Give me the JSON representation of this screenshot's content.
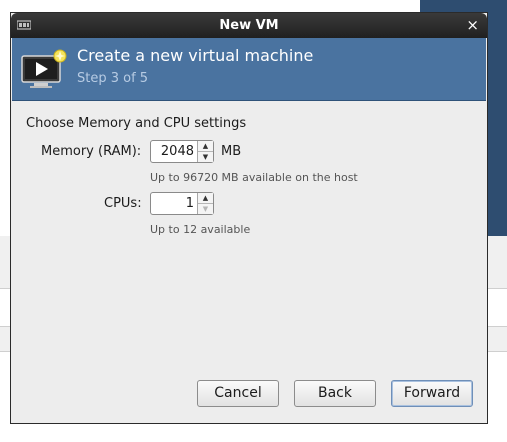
{
  "window": {
    "title": "New VM",
    "close_glyph": "×",
    "app_icon": "vm-app-icon"
  },
  "header": {
    "title": "Create a new virtual machine",
    "step": "Step 3 of 5",
    "icon": "monitor-play-icon"
  },
  "section": {
    "title": "Choose Memory and CPU settings"
  },
  "memory": {
    "label": "Memory (RAM):",
    "value": "2048",
    "unit": "MB",
    "hint": "Up to 96720 MB available on the host"
  },
  "cpus": {
    "label": "CPUs:",
    "value": "1",
    "hint": "Up to 12 available"
  },
  "buttons": {
    "cancel": "Cancel",
    "back": "Back",
    "forward": "Forward"
  },
  "colors": {
    "header_bg": "#4a73a0",
    "step_text": "#b7cbe3",
    "titlebar_bg": "#2a2a2a"
  }
}
